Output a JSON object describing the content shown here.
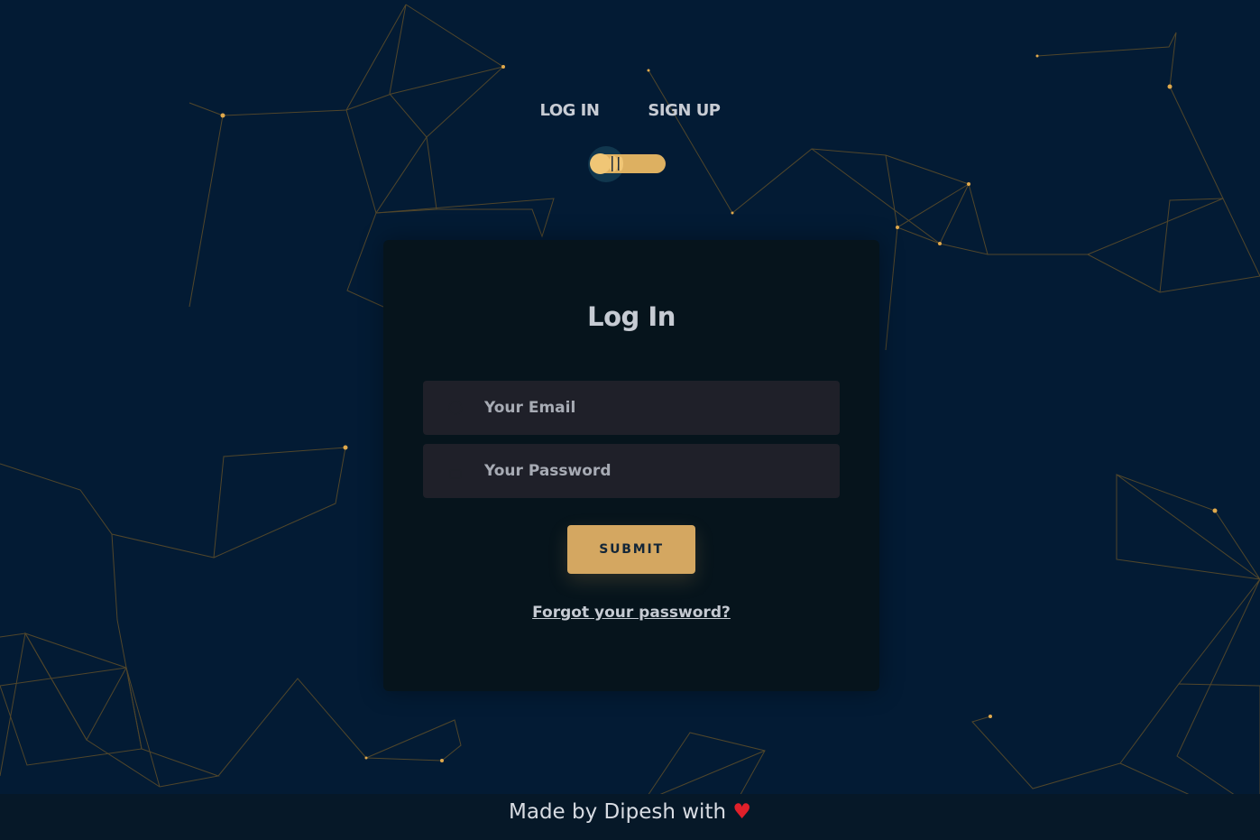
{
  "nav": {
    "tabs": [
      {
        "label": "LOG IN"
      },
      {
        "label": "SIGN UP"
      }
    ],
    "toggle_state": "log-in"
  },
  "form": {
    "title": "Log In",
    "email": {
      "placeholder": "Your Email",
      "value": ""
    },
    "password": {
      "placeholder": "Your Password",
      "value": ""
    },
    "submit_label": "SUBMIT",
    "forgot_link": "Forgot your password?"
  },
  "footer": {
    "text": "Made by Dipesh with ",
    "heart": "♥"
  },
  "colors": {
    "background": "#031b34",
    "card": "#06141c",
    "accent": "#d4a761",
    "field": "#1f2029",
    "text": "#c6cbd3",
    "heart": "#e0202a"
  },
  "icons": {
    "email": "at-icon",
    "password": "lock-icon",
    "background": "constellation-network"
  }
}
